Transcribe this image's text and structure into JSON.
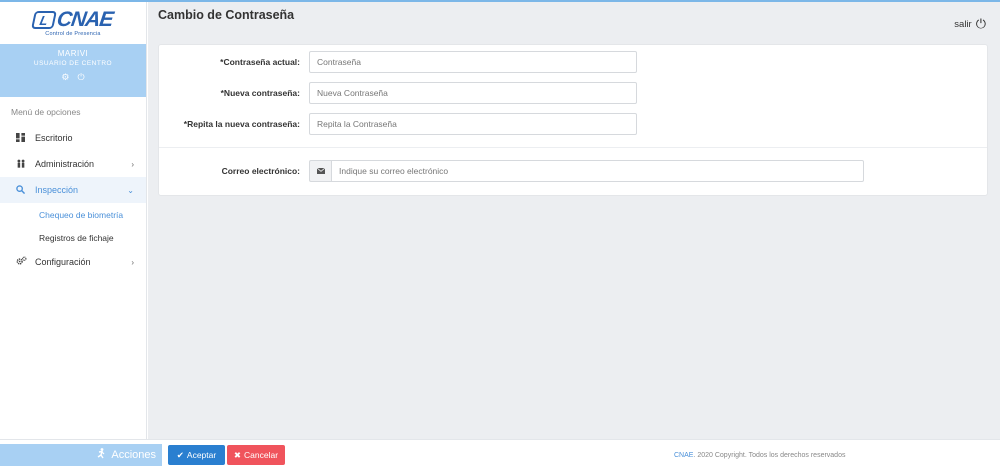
{
  "logo": {
    "mark": "L",
    "text": "CNAE",
    "subtitle": "Control de Presencia"
  },
  "user": {
    "name": "MARIVI",
    "role": "USUARIO DE CENTRO"
  },
  "sidebar": {
    "header": "Menú de opciones",
    "items": [
      {
        "label": "Escritorio",
        "icon": "dashboard-icon",
        "glyph": "▪",
        "has_submenu": false
      },
      {
        "label": "Administración",
        "icon": "users-icon",
        "glyph": "👥",
        "has_submenu": true
      },
      {
        "label": "Inspección",
        "icon": "search-icon",
        "glyph": "⚲",
        "has_submenu": true,
        "expanded": true
      },
      {
        "label": "Configuración",
        "icon": "cogs-icon",
        "glyph": "⚙",
        "has_submenu": true
      }
    ],
    "submenu": [
      {
        "label": "Chequeo de biometría",
        "active": true
      },
      {
        "label": "Registros de fichaje",
        "active": false
      }
    ]
  },
  "header": {
    "title": "Cambio de Contraseña",
    "logout_label": "salir"
  },
  "form": {
    "current_password": {
      "label": "*Contraseña actual:",
      "placeholder": "Contraseña"
    },
    "new_password": {
      "label": "*Nueva contraseña:",
      "placeholder": "Nueva Contraseña"
    },
    "repeat_password": {
      "label": "*Repita la nueva contraseña:",
      "placeholder": "Repita la Contraseña"
    },
    "email": {
      "label": "Correo electrónico:",
      "placeholder": "Indique su correo electrónico"
    }
  },
  "footer": {
    "acciones_label": "Acciones",
    "accept_label": "Aceptar",
    "cancel_label": "Cancelar",
    "copyright_brand": "CNAE",
    "copyright_text": ". 2020 Copyright. Todos los derechos reservados"
  },
  "colors": {
    "accent": "#4a90d9",
    "sidebar_panel": "#a8d0f3",
    "accept": "#2a7fd0",
    "cancel": "#f0545c",
    "background": "#eceef1"
  }
}
